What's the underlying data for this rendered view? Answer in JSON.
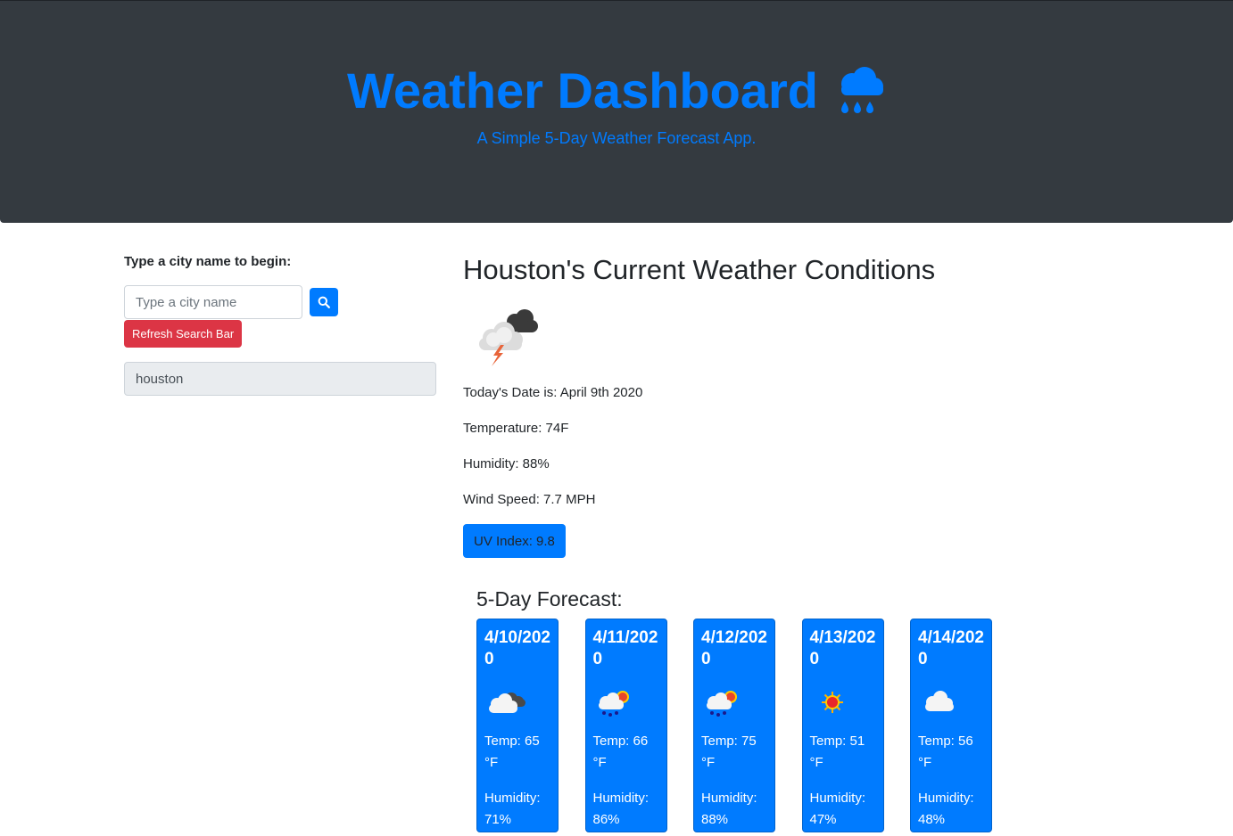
{
  "header": {
    "title": "Weather Dashboard",
    "title_icon": "cloud-rain-icon",
    "subtitle": "A Simple 5-Day Weather Forecast App."
  },
  "sidebar": {
    "prompt": "Type a city name to begin:",
    "search_placeholder": "Type a city name",
    "search_value": "",
    "search_button_icon": "search-icon",
    "refresh_label": "Refresh Search Bar",
    "history": [
      "houston"
    ]
  },
  "current": {
    "heading": "Houston's Current Weather Conditions",
    "icon": "thunderstorm-icon",
    "date": "Today's Date is: April 9th 2020",
    "temperature": "Temperature: 74F",
    "humidity": "Humidity: 88%",
    "wind": "Wind Speed: 7.7 MPH",
    "uv": "UV Index: 9.8"
  },
  "forecast": {
    "heading": "5-Day Forecast:",
    "days": [
      {
        "date": "4/10/2020",
        "icon": "cloudy-icon",
        "temp": "Temp: 65 °F",
        "humidity": "Humidity: 71%"
      },
      {
        "date": "4/11/2020",
        "icon": "sun-rain-icon",
        "temp": "Temp: 66 °F",
        "humidity": "Humidity: 86%"
      },
      {
        "date": "4/12/2020",
        "icon": "sun-rain-icon",
        "temp": "Temp: 75 °F",
        "humidity": "Humidity: 88%"
      },
      {
        "date": "4/13/2020",
        "icon": "sun-icon",
        "temp": "Temp: 51 °F",
        "humidity": "Humidity: 47%"
      },
      {
        "date": "4/14/2020",
        "icon": "cloud-icon",
        "temp": "Temp: 56 °F",
        "humidity": "Humidity: 48%"
      }
    ]
  },
  "colors": {
    "header_bg": "#343a40",
    "primary": "#007bff",
    "danger": "#dc3545",
    "history_bg": "#e9ecef"
  }
}
